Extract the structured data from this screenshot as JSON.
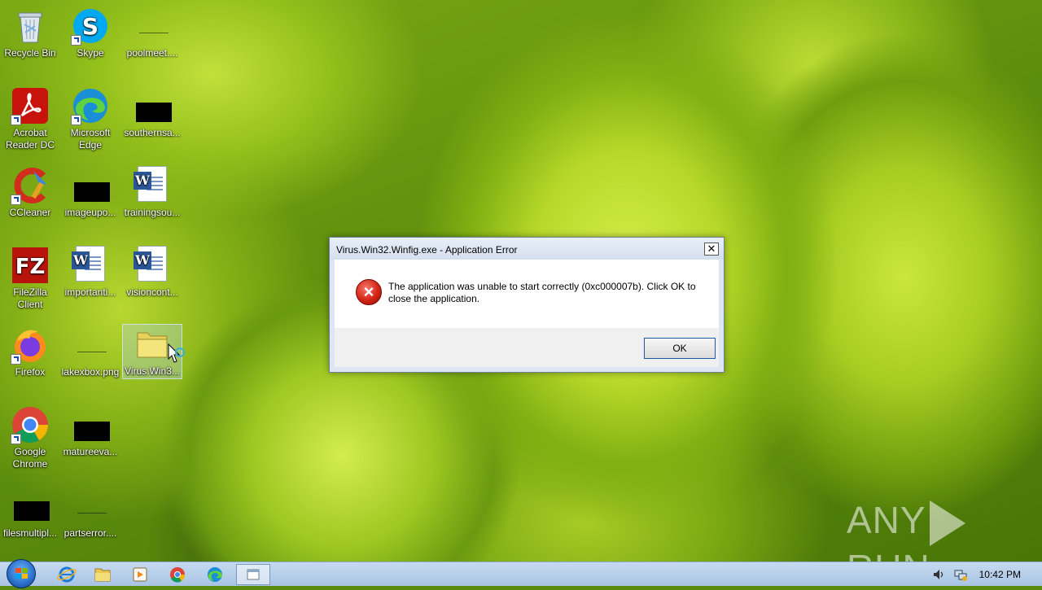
{
  "desktop": {
    "icons": [
      {
        "label": "Recycle Bin"
      },
      {
        "label": "Skype"
      },
      {
        "label": "poolmeet...."
      },
      {
        "label": "Acrobat Reader DC"
      },
      {
        "label": "Microsoft Edge"
      },
      {
        "label": "southernsa..."
      },
      {
        "label": "CCleaner"
      },
      {
        "label": "imageupo..."
      },
      {
        "label": "trainingsou..."
      },
      {
        "label": "FileZilla Client"
      },
      {
        "label": "importanti..."
      },
      {
        "label": "visioncont..."
      },
      {
        "label": "Firefox"
      },
      {
        "label": "lakexbox.png"
      },
      {
        "label": "Virus.Win3..."
      },
      {
        "label": "Google Chrome"
      },
      {
        "label": "matureeva..."
      },
      {
        "label": "filesmultipl..."
      },
      {
        "label": "partserror...."
      }
    ]
  },
  "dialog": {
    "title": "Virus.Win32.Winfig.exe - Application Error",
    "message": "The application was unable to start correctly (0xc000007b). Click OK to close the application.",
    "ok_label": "OK",
    "close_glyph": "✕",
    "icon": "error-icon"
  },
  "watermark": {
    "left": "ANY",
    "right": "RUN"
  },
  "taskbar": {
    "items": [
      "start-button",
      "internet-explorer",
      "file-explorer",
      "media-player",
      "google-chrome",
      "microsoft-edge",
      "running-app"
    ],
    "clock": "10:42 PM"
  },
  "colors": {
    "accent": "#1e5aa8",
    "error": "#d42414",
    "taskbar": "#b8cfea"
  }
}
